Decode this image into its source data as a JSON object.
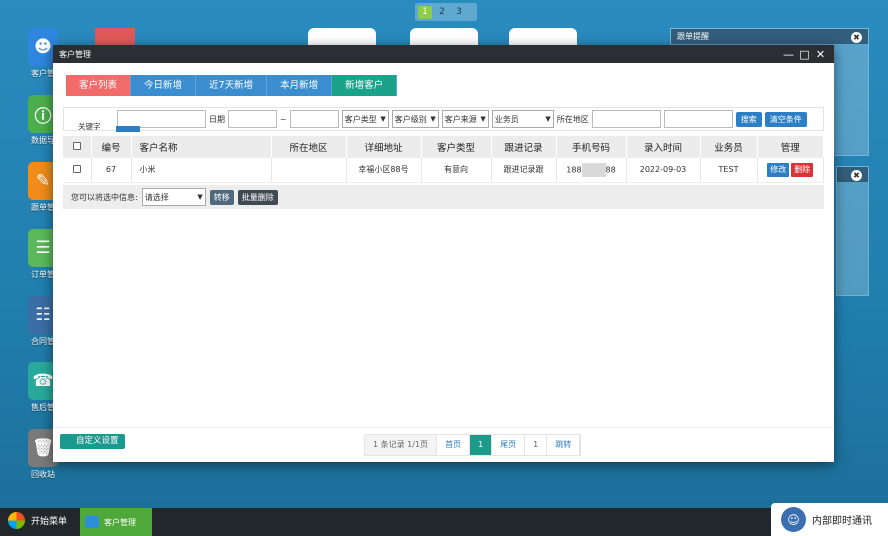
{
  "desktop": {
    "pages": [
      "1",
      "2",
      "3"
    ],
    "active_page": "1",
    "icons": [
      {
        "label": "客户管",
        "icon": "user-group-icon",
        "color": "#2e86de"
      },
      {
        "label": "数据导",
        "icon": "info-icon",
        "color": "#4cae4c"
      },
      {
        "label": "跟单管",
        "icon": "edit-icon",
        "color": "#f08c1a"
      },
      {
        "label": "订单管",
        "icon": "clipboard-icon",
        "color": "#5cb85c"
      },
      {
        "label": "合同管",
        "icon": "notebook-icon",
        "color": "#3a6ea5"
      },
      {
        "label": "售后管",
        "icon": "support-icon",
        "color": "#28a99b"
      },
      {
        "label": "回收站",
        "icon": "trash-icon",
        "color": "#7a7a7a"
      }
    ],
    "widgets": [
      {
        "title": "跟单提醒"
      }
    ]
  },
  "window": {
    "title": "客户管理",
    "controls": [
      "minimize-icon",
      "maximize-icon",
      "close-icon"
    ]
  },
  "tabs": [
    "客户列表",
    "今日新增",
    "近7天新增",
    "本月新增",
    "新增客户"
  ],
  "filter": {
    "keyword_label": "关键字",
    "date_label": "日期",
    "range_sep": "~",
    "customer_type": "客户类型",
    "customer_level": "客户级别",
    "customer_source": "客户来源",
    "salesman": "业务员",
    "region_label": "所在地区",
    "search_button": "搜索",
    "clear_button": "清空条件"
  },
  "table": {
    "headers": [
      "编号",
      "客户名称",
      "所在地区",
      "详细地址",
      "客户类型",
      "跟进记录",
      "手机号码",
      "录入时间",
      "业务员",
      "管理"
    ],
    "rows": [
      {
        "id": "67",
        "name": "小米",
        "region": "",
        "address": "幸福小区88号",
        "type": "有意向",
        "followup": "跟进记录跟",
        "phone_prefix": "188",
        "phone_suffix": "88",
        "created": "2022-09-03",
        "salesman": "TEST",
        "edit": "修改",
        "delete": "删除"
      }
    ]
  },
  "batch": {
    "label": "您可以将选中信息:",
    "select_value": "请选择",
    "move_button": "转移",
    "delete_button": "批量删除"
  },
  "footer": {
    "custom_button": "自定义设置",
    "pager": {
      "info": "1 条记录 1/1页",
      "first": "首页",
      "current": "1",
      "last": "尾页",
      "goto_value": "1",
      "jump": "跳转"
    }
  },
  "taskbar": {
    "start": "开始菜单",
    "task": "客户管理",
    "chat": "内部即时通讯"
  }
}
